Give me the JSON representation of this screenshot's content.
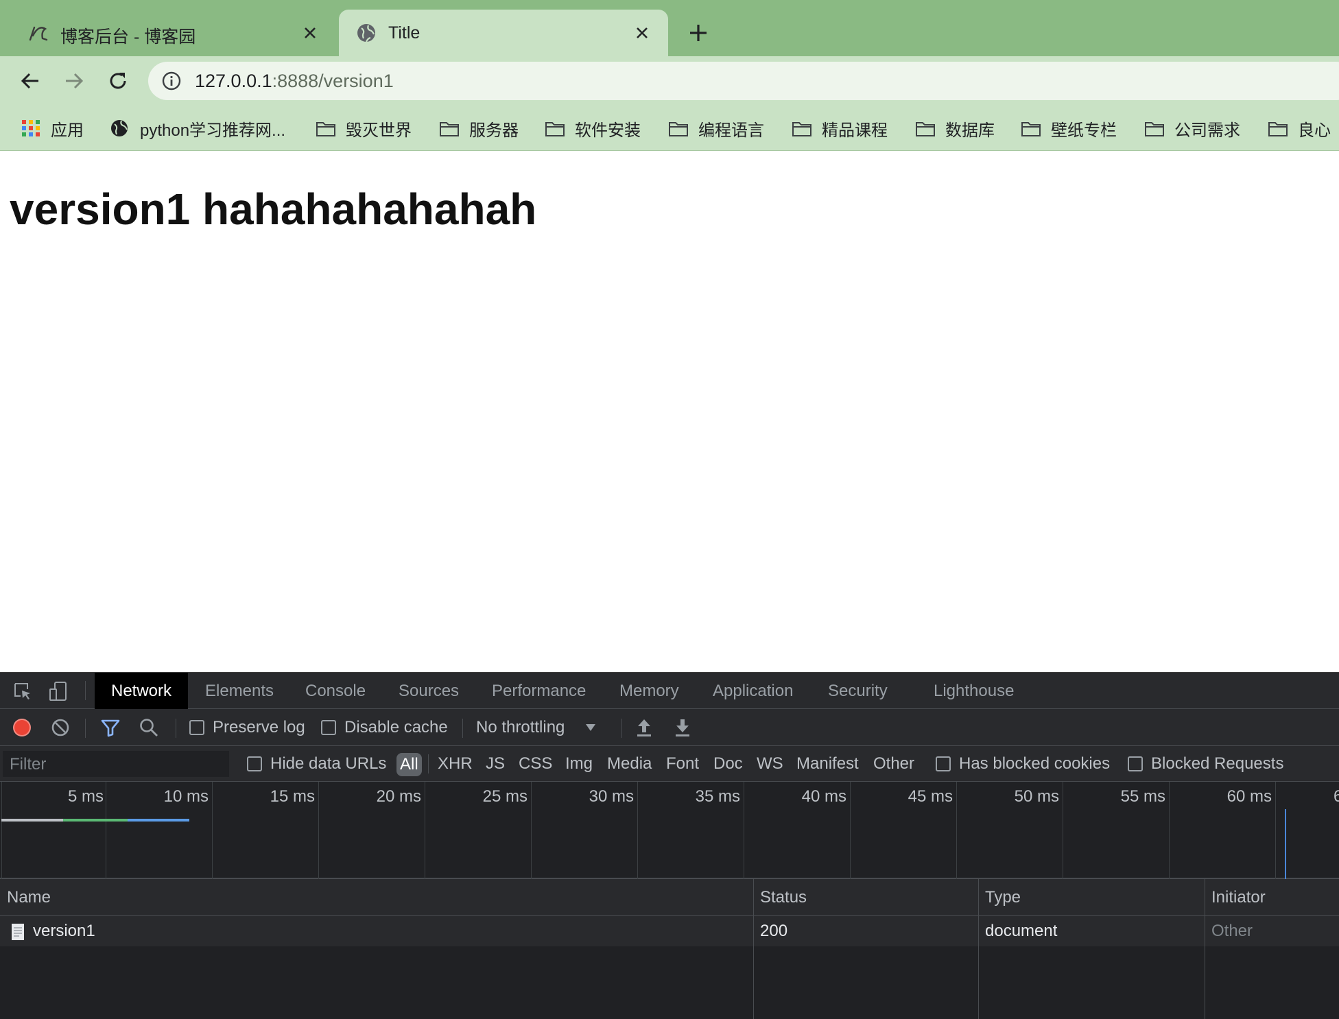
{
  "browser": {
    "tabs": [
      {
        "title": "博客后台 - 博客园",
        "icon": "cnblogs-icon",
        "active": false
      },
      {
        "title": "Title",
        "icon": "globe-icon",
        "active": true
      }
    ],
    "url_host": "127.0.0.1",
    "url_rest": ":8888/version1",
    "bookmarks": [
      {
        "label": "应用",
        "icon": "apps-grid-icon"
      },
      {
        "label": "python学习推荐网...",
        "icon": "globe-icon"
      },
      {
        "label": "毁灭世界",
        "icon": "folder-icon"
      },
      {
        "label": "服务器",
        "icon": "folder-icon"
      },
      {
        "label": "软件安装",
        "icon": "folder-icon"
      },
      {
        "label": "编程语言",
        "icon": "folder-icon"
      },
      {
        "label": "精品课程",
        "icon": "folder-icon"
      },
      {
        "label": "数据库",
        "icon": "folder-icon"
      },
      {
        "label": "壁纸专栏",
        "icon": "folder-icon"
      },
      {
        "label": "公司需求",
        "icon": "folder-icon"
      },
      {
        "label": "良心",
        "icon": "folder-icon"
      }
    ],
    "colors": {
      "tabstrip": "#8aba83",
      "toolbar": "#c9e2c5"
    }
  },
  "page": {
    "heading": "version1 hahahahahahah"
  },
  "devtools": {
    "tabs": [
      "Network",
      "Elements",
      "Console",
      "Sources",
      "Performance",
      "Memory",
      "Application",
      "Security",
      "Lighthouse"
    ],
    "active_tab": "Network",
    "toolbar": {
      "preserve_log": "Preserve log",
      "disable_cache": "Disable cache",
      "throttling": "No throttling"
    },
    "filter": {
      "placeholder": "Filter",
      "hide_data_urls": "Hide data URLs",
      "types": [
        "All",
        "XHR",
        "JS",
        "CSS",
        "Img",
        "Media",
        "Font",
        "Doc",
        "WS",
        "Manifest",
        "Other"
      ],
      "has_blocked_cookies": "Has blocked cookies",
      "blocked_requests": "Blocked Requests"
    },
    "timeline_ticks": [
      "5 ms",
      "10 ms",
      "15 ms",
      "20 ms",
      "25 ms",
      "30 ms",
      "35 ms",
      "40 ms",
      "45 ms",
      "50 ms",
      "55 ms",
      "60 ms",
      "6"
    ],
    "columns": {
      "name": "Name",
      "status": "Status",
      "type": "Type",
      "initiator": "Initiator"
    },
    "requests": [
      {
        "name": "version1",
        "status": "200",
        "type": "document",
        "initiator": "Other"
      }
    ]
  }
}
